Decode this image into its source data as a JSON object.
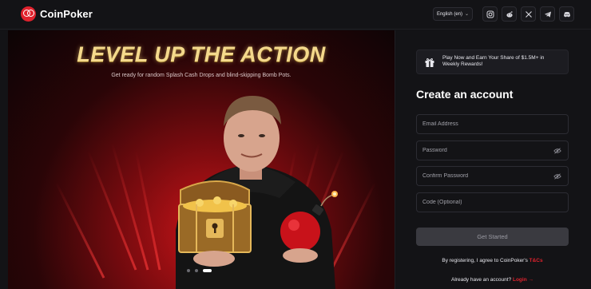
{
  "header": {
    "brand": "CoinPoker",
    "language": "English (en)",
    "socials": [
      "instagram-icon",
      "reddit-icon",
      "x-icon",
      "telegram-icon",
      "discord-icon"
    ]
  },
  "hero": {
    "title": "LEVEL UP THE ACTION",
    "subtitle": "Get ready for random Splash Cash Drops and blind-skipping Bomb Pots.",
    "carousel": {
      "slides": 3,
      "active": 3
    }
  },
  "panel": {
    "promo": "Play Now and Earn Your Share of $1.5M+ in Weekly Rewards!",
    "title": "Create an account",
    "fields": {
      "email": "Email Address",
      "password": "Password",
      "confirm": "Confirm Password",
      "code": "Code (Optional)"
    },
    "submit": "Get Started",
    "terms_text": "By registering, I agree to CoinPoker's ",
    "terms_link": "T&Cs",
    "login_text": "Already have an account? ",
    "login_link": "Login →"
  },
  "colors": {
    "accent": "#e0222d",
    "background": "#131316",
    "gold": "#f4d98c"
  }
}
